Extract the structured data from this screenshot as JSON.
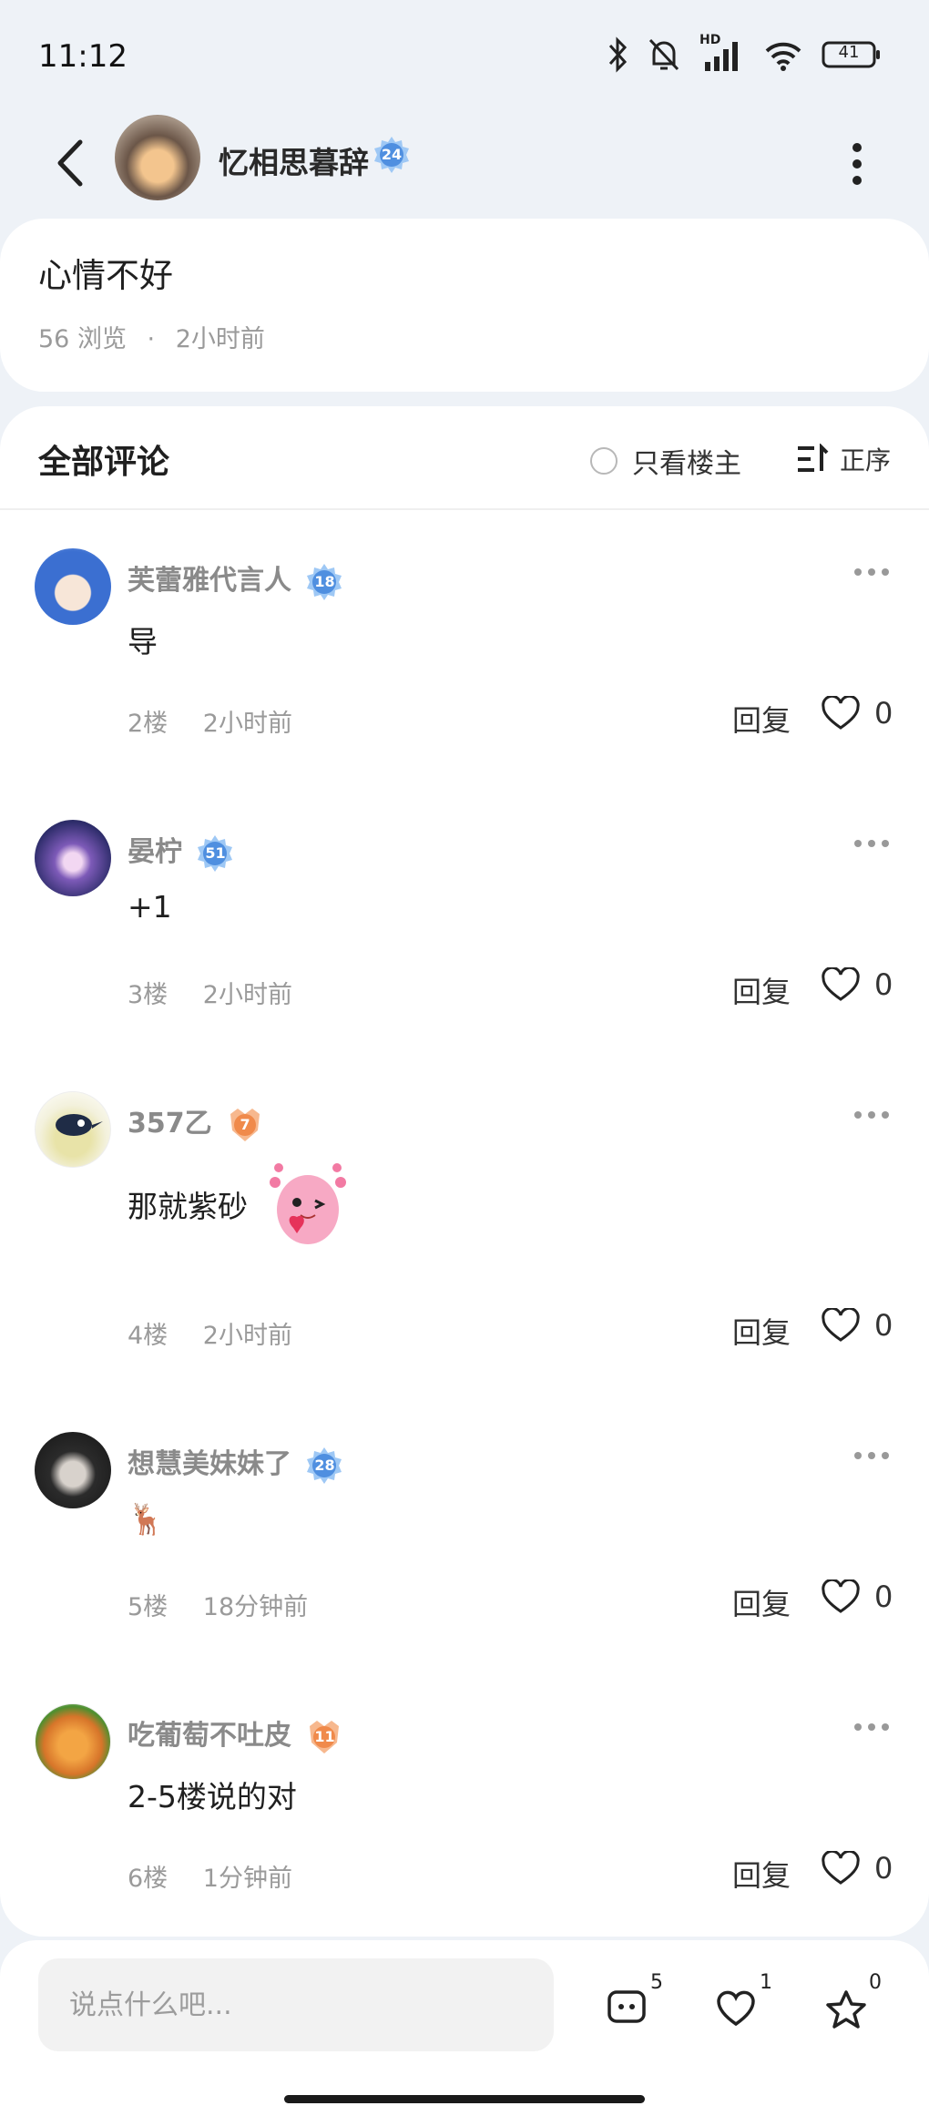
{
  "status_bar": {
    "time": "11:12",
    "battery": "41",
    "network_label": "HD"
  },
  "header": {
    "author_name": "忆相思暮辞",
    "author_level": "24"
  },
  "post": {
    "title": "心情不好",
    "views": "56 浏览",
    "dot": "·",
    "time": "2小时前"
  },
  "comments_section": {
    "title": "全部评论",
    "only_op_label": "只看楼主",
    "sort_label": "正序",
    "reply_label": "回复",
    "items": [
      {
        "name": "芙蕾雅代言人",
        "level": "18",
        "content": "导",
        "floor": "2楼",
        "time": "2小时前",
        "likes": "0"
      },
      {
        "name": "晏柠",
        "level": "51",
        "content": "+1",
        "floor": "3楼",
        "time": "2小时前",
        "likes": "0"
      },
      {
        "name": "357乙",
        "level": "7",
        "content": "那就紫砂",
        "floor": "4楼",
        "time": "2小时前",
        "likes": "0"
      },
      {
        "name": "想慧美妹妹了",
        "level": "28",
        "content": "🦌",
        "floor": "5楼",
        "time": "18分钟前",
        "likes": "0"
      },
      {
        "name": "吃葡萄不吐皮",
        "level": "11",
        "content": "2-5楼说的对",
        "floor": "6楼",
        "time": "1分钟前",
        "likes": "0"
      }
    ]
  },
  "bottom_bar": {
    "placeholder": "说点什么吧...",
    "comment_count": "5",
    "like_count": "1",
    "favorite_count": "0"
  },
  "colors": {
    "badge_blue": "#5b9fe8",
    "badge_orange": "#f08a4b",
    "background": "#eef2f7"
  }
}
